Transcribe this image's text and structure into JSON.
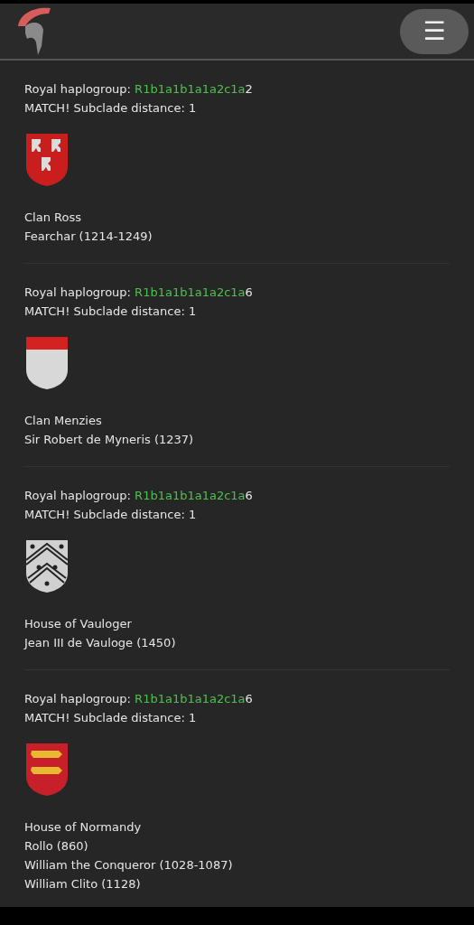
{
  "header": {
    "menu_button": "☰"
  },
  "entries": [
    {
      "label": "Royal haplogroup:",
      "haplogroup": "R1b1a1b1a1a2c1a",
      "suffix": "2",
      "match": "MATCH! Subclade distance: 1",
      "kind": "lions",
      "lines": [
        "Clan Ross",
        "Fearchar (1214-1249)"
      ]
    },
    {
      "label": "Royal haplogroup:",
      "haplogroup": "R1b1a1b1a1a2c1a",
      "suffix": "6",
      "match": "MATCH! Subclade distance: 1",
      "kind": "chief",
      "lines": [
        "Clan Menzies",
        "Sir Robert de Myneris (1237)"
      ]
    },
    {
      "label": "Royal haplogroup:",
      "haplogroup": "R1b1a1b1a1a2c1a",
      "suffix": "6",
      "match": "MATCH! Subclade distance: 1",
      "kind": "chevrons",
      "lines": [
        "House of Vauloger",
        "Jean III de Vauloge (1450)"
      ]
    },
    {
      "label": "Royal haplogroup:",
      "haplogroup": "R1b1a1b1a1a2c1a",
      "suffix": "6",
      "match": "MATCH! Subclade distance: 1",
      "kind": "leopards",
      "lines": [
        "House of Normandy",
        "Rollo (860)",
        "William the Conqueror (1028-1087)",
        "William Clito (1128)"
      ]
    }
  ]
}
